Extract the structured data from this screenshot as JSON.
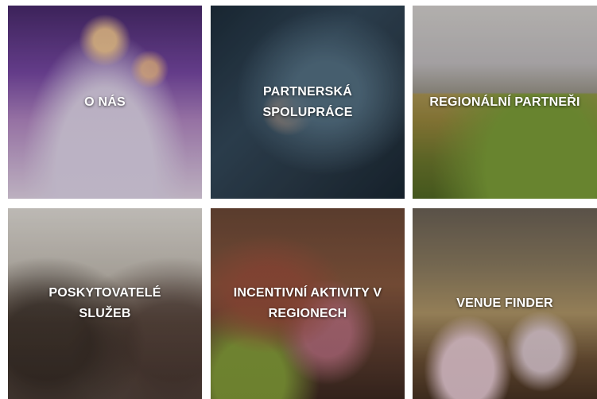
{
  "tiles": [
    {
      "label": "O NÁS"
    },
    {
      "label_line1": "PARTNERSKÁ",
      "label_line2": "SPOLUPRÁCE"
    },
    {
      "label": "REGIONÁLNÍ PARTNEŘI"
    },
    {
      "label_line1": "POSKYTOVATELÉ",
      "label_line2": "SLUŽEB"
    },
    {
      "label_line1": "INCENTIVNÍ AKTIVITY V",
      "label_line2": "REGIONECH"
    },
    {
      "label": "VENUE FINDER"
    }
  ]
}
